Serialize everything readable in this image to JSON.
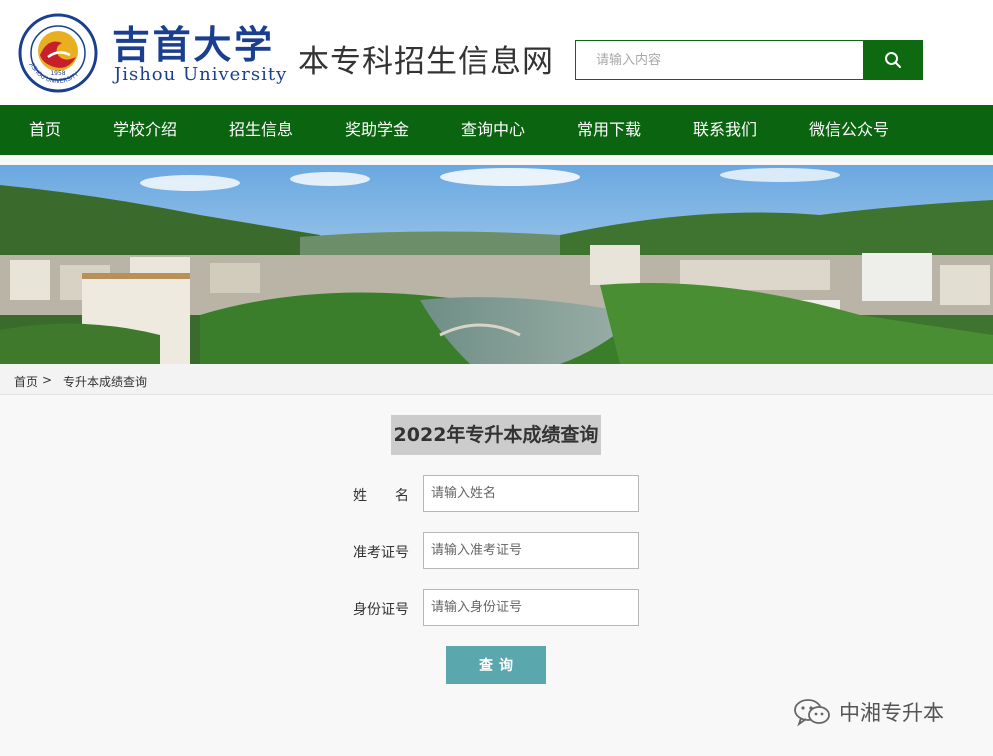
{
  "header": {
    "logo_seal_year": "1958",
    "logo_seal_ring_text": "JISHOU UNIVERSITY",
    "logo_cn": "吉首大学",
    "logo_en": "Jishou University",
    "site_title": "本专科招生信息网",
    "search_placeholder": "请输入内容"
  },
  "nav": {
    "items": [
      "首页",
      "学校介绍",
      "招生信息",
      "奖助学金",
      "查询中心",
      "常用下载",
      "联系我们",
      "微信公众号"
    ]
  },
  "breadcrumb": {
    "home": "首页",
    "separator": ">",
    "current": "专升本成绩查询"
  },
  "form": {
    "title": "2022年专升本成绩查询",
    "name_label": "姓　　名",
    "name_placeholder": "请输入姓名",
    "ticket_label": "准考证号",
    "ticket_placeholder": "请输入准考证号",
    "id_label": "身份证号",
    "id_placeholder": "请输入身份证号",
    "submit_label": "查询"
  },
  "watermark": {
    "text": "中湘专升本"
  },
  "colors": {
    "brand_green": "#0b6410",
    "button_teal": "#5ba7ae",
    "logo_blue": "#1a3f8f",
    "logo_red": "#c8202a"
  },
  "icons": {
    "search": "search-icon",
    "wechat": "wechat-icon"
  }
}
